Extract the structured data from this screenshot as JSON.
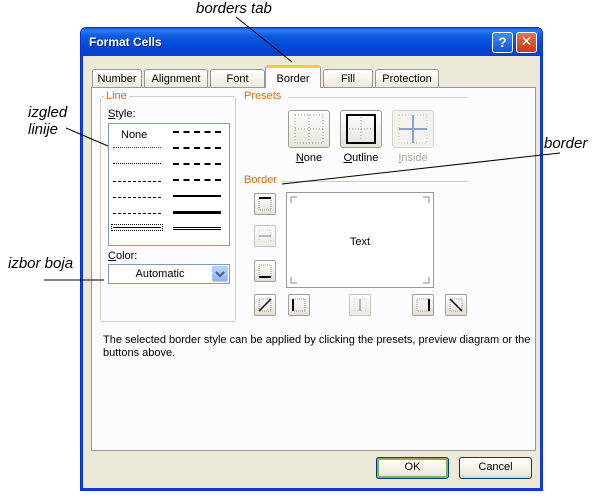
{
  "annotations": {
    "borders_tab": "borders tab",
    "izgled": "izgled",
    "linije": "linije",
    "border": "border",
    "izbor_boja": "izbor boja"
  },
  "dialog": {
    "title": "Format Cells",
    "help_label": "?",
    "close_label": "✕",
    "tabs": [
      "Number",
      "Alignment",
      "Font",
      "Border",
      "Fill",
      "Protection"
    ],
    "active_tab": "Border"
  },
  "line_group": {
    "title": "Line",
    "style_label_u": "S",
    "style_label_rest": "tyle:",
    "none_label": "None",
    "color_label_u": "C",
    "color_label_rest": "olor:",
    "color_value": "Automatic"
  },
  "presets": {
    "title": "Presets",
    "none_u": "N",
    "none_rest": "one",
    "outline_u": "O",
    "outline_rest": "utline",
    "inside_u": "I",
    "inside_rest": "nside"
  },
  "border_group": {
    "title": "Border",
    "preview_text": "Text"
  },
  "description": "The selected border style can be applied by clicking the presets, preview diagram or the buttons above.",
  "buttons": {
    "ok": "OK",
    "cancel": "Cancel"
  },
  "colors": {
    "titlebar": "#0a5ddf",
    "group_label": "#e8650e",
    "dialog_bg": "#ece9d8",
    "active_tab_top": "#ffc83c"
  }
}
